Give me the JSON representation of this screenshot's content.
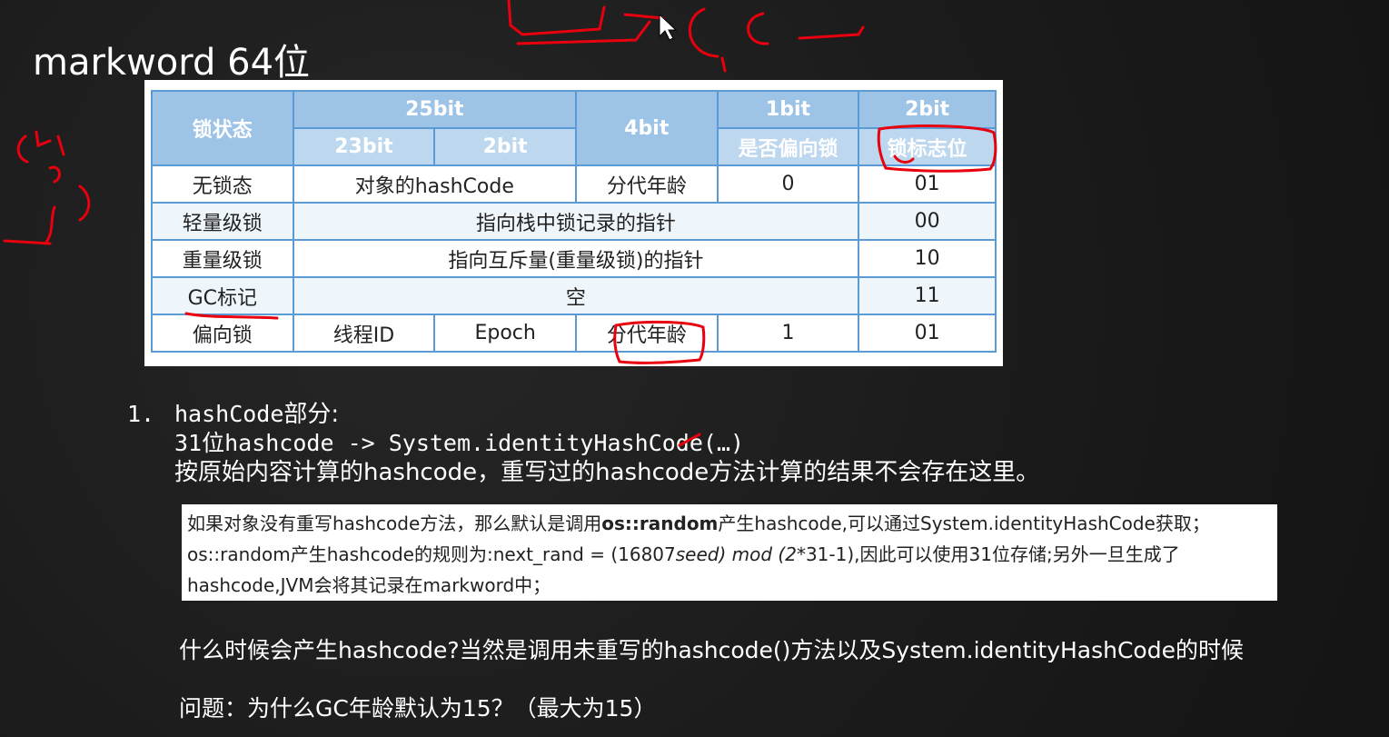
{
  "title": "markword 64位",
  "table": {
    "headers": {
      "lock_state": "锁状态",
      "bits25": "25bit",
      "bits4": "4bit",
      "bits1": "1bit",
      "bits2": "2bit",
      "bits23": "23bit",
      "bits2sub": "2bit",
      "biased_flag": "是否偏向锁",
      "lock_flag": "锁标志位"
    },
    "rows": [
      {
        "state": "无锁态",
        "a": "对象的hashCode",
        "age": "分代年龄",
        "biased": "0",
        "flag": "01"
      },
      {
        "state": "轻量级锁",
        "a": "指向栈中锁记录的指针",
        "flag": "00"
      },
      {
        "state": "重量级锁",
        "a": "指向互斥量(重量级锁)的指针",
        "flag": "10"
      },
      {
        "state": "GC标记",
        "a": "空",
        "flag": "11"
      },
      {
        "state": "偏向锁",
        "thread": "线程ID",
        "epoch": "Epoch",
        "age": "分代年龄",
        "biased": "1",
        "flag": "01"
      }
    ]
  },
  "list": {
    "number": "1.",
    "line1_code": "hashCode",
    "line1_zh": "部分:",
    "line2": "31位hashcode -> System.identityHashCode(…)",
    "line3": "按原始内容计算的hashcode，重写过的hashcode方法计算的结果不会存在这里。"
  },
  "note": {
    "l1a": "如果对象没有重写hashcode方法，那么默认是调用",
    "l1b": "os::random",
    "l1c": "产生hashcode,可以通过System.identityHashCode获取；",
    "l2a": "os::random产生hashcode的规则为:next_rand = (16807",
    "l2b": "seed) mod (2",
    "l2c": "*31-1),因此可以使用31位存储;另外一旦生成了",
    "l3": "hashcode,JVM会将其记录在markword中；"
  },
  "q1": "什么时候会产生hashcode?当然是调用未重写的hashcode()方法以及System.identityHashCode的时候",
  "q2": "问题：为什么GC年龄默认为15？（最大为15）"
}
